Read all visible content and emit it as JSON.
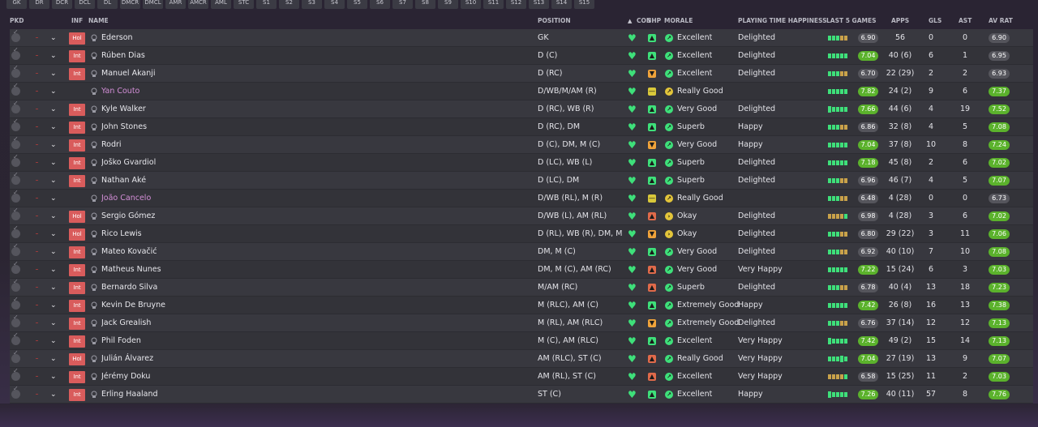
{
  "filter_tabs": [
    "GK",
    "DR",
    "DCR",
    "DCL",
    "DL",
    "DMCR",
    "DMCL",
    "AMR",
    "AMCR",
    "AML",
    "STC",
    "S1",
    "S2",
    "S3",
    "S4",
    "S5",
    "S6",
    "S7",
    "S8",
    "S9",
    "S10",
    "S11",
    "S12",
    "S13",
    "S14",
    "S15"
  ],
  "columns": {
    "pkd": "PKD",
    "inf": "INF",
    "name": "NAME",
    "position": "POSITION",
    "con": "CON",
    "shp": "SHP",
    "morale": "MORALE",
    "pth": "PLAYING TIME HAPPINESS",
    "last5": "LAST 5 GAMES",
    "apps": "APPS",
    "gls": "GLS",
    "ast": "AST",
    "avrat": "AV RAT"
  },
  "sort_indicator": "▲",
  "colors": {
    "green": "#3ee07a",
    "rating_green": "#5bb22c",
    "rating_gray": "#55555c",
    "inf_red": "#d95c5c",
    "shp_orange": "#f0a33a",
    "shp_red": "#e06a4a",
    "shp_yellow": "#d9c83a",
    "morale_yellow": "#e3c53a",
    "loan_purple": "#d48fd8"
  },
  "players": [
    {
      "inf": "Hol",
      "name": "Ederson",
      "pos": "GK",
      "shp": "up",
      "morale_icon": "up",
      "morale": "Excellent",
      "pth": "Delighted",
      "form": [
        "g",
        "g",
        "g",
        "o",
        "o"
      ],
      "last": "6.90",
      "last_green": false,
      "apps": "56",
      "gls": "0",
      "ast": "0",
      "av": "6.90",
      "av_green": false
    },
    {
      "inf": "Int",
      "name": "Rúben Dias",
      "pos": "D (C)",
      "shp": "up",
      "morale_icon": "up",
      "morale": "Excellent",
      "pth": "Delighted",
      "form": [
        "g",
        "g",
        "g",
        "g",
        "g"
      ],
      "last": "7.04",
      "last_green": true,
      "apps": "40 (6)",
      "gls": "6",
      "ast": "1",
      "av": "6.95",
      "av_green": false
    },
    {
      "inf": "Int",
      "name": "Manuel Akanji",
      "pos": "D (RC)",
      "shp": "down",
      "morale_icon": "up",
      "morale": "Excellent",
      "pth": "Delighted",
      "form": [
        "g",
        "g",
        "g",
        "o",
        "o"
      ],
      "last": "6.70",
      "last_green": false,
      "apps": "22 (29)",
      "gls": "2",
      "ast": "2",
      "av": "6.93",
      "av_green": false
    },
    {
      "inf": "",
      "name": "Yan Couto",
      "loan": true,
      "pos": "D/WB/M/AM (R)",
      "shp": "flat",
      "morale_icon": "flat",
      "morale": "Really Good",
      "pth": "",
      "form": [
        "g",
        "g",
        "g",
        "g",
        "g"
      ],
      "last": "7.82",
      "last_green": true,
      "apps": "24 (2)",
      "gls": "9",
      "ast": "6",
      "av": "7.37",
      "av_green": true
    },
    {
      "inf": "Int",
      "name": "Kyle Walker",
      "pos": "D (RC), WB (R)",
      "shp": "up",
      "morale_icon": "up",
      "morale": "Very Good",
      "pth": "Delighted",
      "form": [
        "G",
        "g",
        "g",
        "g",
        "g"
      ],
      "last": "7.66",
      "last_green": true,
      "apps": "44 (6)",
      "gls": "4",
      "ast": "19",
      "av": "7.52",
      "av_green": true
    },
    {
      "inf": "Int",
      "name": "John Stones",
      "pos": "D (RC), DM",
      "shp": "up",
      "morale_icon": "up",
      "morale": "Superb",
      "pth": "Happy",
      "form": [
        "g",
        "g",
        "g",
        "o",
        "o"
      ],
      "last": "6.86",
      "last_green": false,
      "apps": "32 (8)",
      "gls": "4",
      "ast": "5",
      "av": "7.08",
      "av_green": true
    },
    {
      "inf": "Int",
      "name": "Rodri",
      "pos": "D (C), DM, M (C)",
      "shp": "down",
      "morale_icon": "up",
      "morale": "Very Good",
      "pth": "Happy",
      "form": [
        "g",
        "g",
        "g",
        "g",
        "g"
      ],
      "last": "7.04",
      "last_green": true,
      "apps": "37 (8)",
      "gls": "10",
      "ast": "8",
      "av": "7.24",
      "av_green": true
    },
    {
      "inf": "Int",
      "name": "Joško Gvardiol",
      "pos": "D (LC), WB (L)",
      "shp": "up",
      "morale_icon": "up",
      "morale": "Superb",
      "pth": "Delighted",
      "form": [
        "g",
        "g",
        "g",
        "g",
        "g"
      ],
      "last": "7.18",
      "last_green": true,
      "apps": "45 (8)",
      "gls": "2",
      "ast": "6",
      "av": "7.02",
      "av_green": true
    },
    {
      "inf": "Int",
      "name": "Nathan Aké",
      "pos": "D (LC), DM",
      "shp": "up",
      "morale_icon": "up",
      "morale": "Superb",
      "pth": "Delighted",
      "form": [
        "g",
        "g",
        "g",
        "o",
        "o"
      ],
      "last": "6.96",
      "last_green": false,
      "apps": "46 (7)",
      "gls": "4",
      "ast": "5",
      "av": "7.07",
      "av_green": true
    },
    {
      "inf": "",
      "name": "João Cancelo",
      "loan": true,
      "pos": "D/WB (RL), M (R)",
      "shp": "flat",
      "morale_icon": "flat",
      "morale": "Really Good",
      "pth": "",
      "form": [
        "g",
        "g",
        "g",
        "o",
        "o"
      ],
      "last": "6.48",
      "last_green": false,
      "apps": "4 (28)",
      "gls": "0",
      "ast": "0",
      "av": "6.73",
      "av_green": false
    },
    {
      "inf": "Hol",
      "name": "Sergio Gómez",
      "pos": "D/WB (L), AM (RL)",
      "shp": "red",
      "morale_icon": "right",
      "morale": "Okay",
      "pth": "Delighted",
      "form": [
        "o",
        "o",
        "o",
        "o",
        "g"
      ],
      "last": "6.98",
      "last_green": false,
      "apps": "4 (28)",
      "gls": "3",
      "ast": "6",
      "av": "7.02",
      "av_green": true
    },
    {
      "inf": "Hol",
      "name": "Rico Lewis",
      "pos": "D (RL), WB (R), DM, M...",
      "shp": "down",
      "morale_icon": "right",
      "morale": "Okay",
      "pth": "Delighted",
      "form": [
        "g",
        "g",
        "g",
        "o",
        "o"
      ],
      "last": "6.80",
      "last_green": false,
      "apps": "29 (22)",
      "gls": "3",
      "ast": "11",
      "av": "7.06",
      "av_green": true
    },
    {
      "inf": "Int",
      "name": "Mateo Kovačić",
      "pos": "DM, M (C)",
      "shp": "up",
      "morale_icon": "up",
      "morale": "Very Good",
      "pth": "Delighted",
      "form": [
        "g",
        "g",
        "g",
        "o",
        "o"
      ],
      "last": "6.92",
      "last_green": false,
      "apps": "40 (10)",
      "gls": "7",
      "ast": "10",
      "av": "7.08",
      "av_green": true
    },
    {
      "inf": "Int",
      "name": "Matheus Nunes",
      "pos": "DM, M (C), AM (RC)",
      "shp": "red",
      "morale_icon": "up",
      "morale": "Very Good",
      "pth": "Very Happy",
      "form": [
        "g",
        "g",
        "g",
        "g",
        "g"
      ],
      "last": "7.22",
      "last_green": true,
      "apps": "15 (24)",
      "gls": "6",
      "ast": "3",
      "av": "7.03",
      "av_green": true
    },
    {
      "inf": "Int",
      "name": "Bernardo Silva",
      "pos": "M/AM (RC)",
      "shp": "red",
      "morale_icon": "up",
      "morale": "Superb",
      "pth": "Delighted",
      "form": [
        "g",
        "g",
        "g",
        "o",
        "o"
      ],
      "last": "6.78",
      "last_green": false,
      "apps": "40 (4)",
      "gls": "13",
      "ast": "18",
      "av": "7.23",
      "av_green": true
    },
    {
      "inf": "Int",
      "name": "Kevin De Bruyne",
      "pos": "M (RLC), AM (C)",
      "shp": "up",
      "morale_icon": "up",
      "morale": "Extremely Good",
      "pth": "Happy",
      "form": [
        "g",
        "g",
        "g",
        "g",
        "g"
      ],
      "last": "7.42",
      "last_green": true,
      "apps": "26 (8)",
      "gls": "16",
      "ast": "13",
      "av": "7.38",
      "av_green": true
    },
    {
      "inf": "Int",
      "name": "Jack Grealish",
      "pos": "M (RL), AM (RLC)",
      "shp": "down",
      "morale_icon": "up",
      "morale": "Extremely Good",
      "pth": "Delighted",
      "form": [
        "g",
        "g",
        "g",
        "o",
        "o"
      ],
      "last": "6.76",
      "last_green": false,
      "apps": "37 (14)",
      "gls": "12",
      "ast": "12",
      "av": "7.13",
      "av_green": true
    },
    {
      "inf": "Int",
      "name": "Phil Foden",
      "pos": "M (C), AM (RLC)",
      "shp": "up",
      "morale_icon": "up",
      "morale": "Excellent",
      "pth": "Very Happy",
      "form": [
        "G",
        "g",
        "g",
        "g",
        "g"
      ],
      "last": "7.42",
      "last_green": true,
      "apps": "49 (2)",
      "gls": "15",
      "ast": "14",
      "av": "7.13",
      "av_green": true
    },
    {
      "inf": "Hol",
      "name": "Julián Álvarez",
      "pos": "AM (RLC), ST (C)",
      "shp": "red",
      "morale_icon": "up",
      "morale": "Really Good",
      "pth": "Very Happy",
      "form": [
        "g",
        "g",
        "g",
        "G",
        "g"
      ],
      "last": "7.04",
      "last_green": true,
      "apps": "27 (19)",
      "gls": "13",
      "ast": "9",
      "av": "7.07",
      "av_green": true
    },
    {
      "inf": "Int",
      "name": "Jérémy Doku",
      "pos": "AM (RL), ST (C)",
      "shp": "red",
      "morale_icon": "up",
      "morale": "Excellent",
      "pth": "Very Happy",
      "form": [
        "o",
        "o",
        "o",
        "o",
        "g"
      ],
      "last": "6.58",
      "last_green": false,
      "apps": "15 (25)",
      "gls": "11",
      "ast": "2",
      "av": "7.03",
      "av_green": true
    },
    {
      "inf": "Int",
      "name": "Erling Haaland",
      "pos": "ST (C)",
      "shp": "up",
      "morale_icon": "up",
      "morale": "Excellent",
      "pth": "Happy",
      "form": [
        "G",
        "g",
        "g",
        "g",
        "g"
      ],
      "last": "7.26",
      "last_green": true,
      "apps": "40 (11)",
      "gls": "57",
      "ast": "8",
      "av": "7.76",
      "av_green": true
    }
  ]
}
